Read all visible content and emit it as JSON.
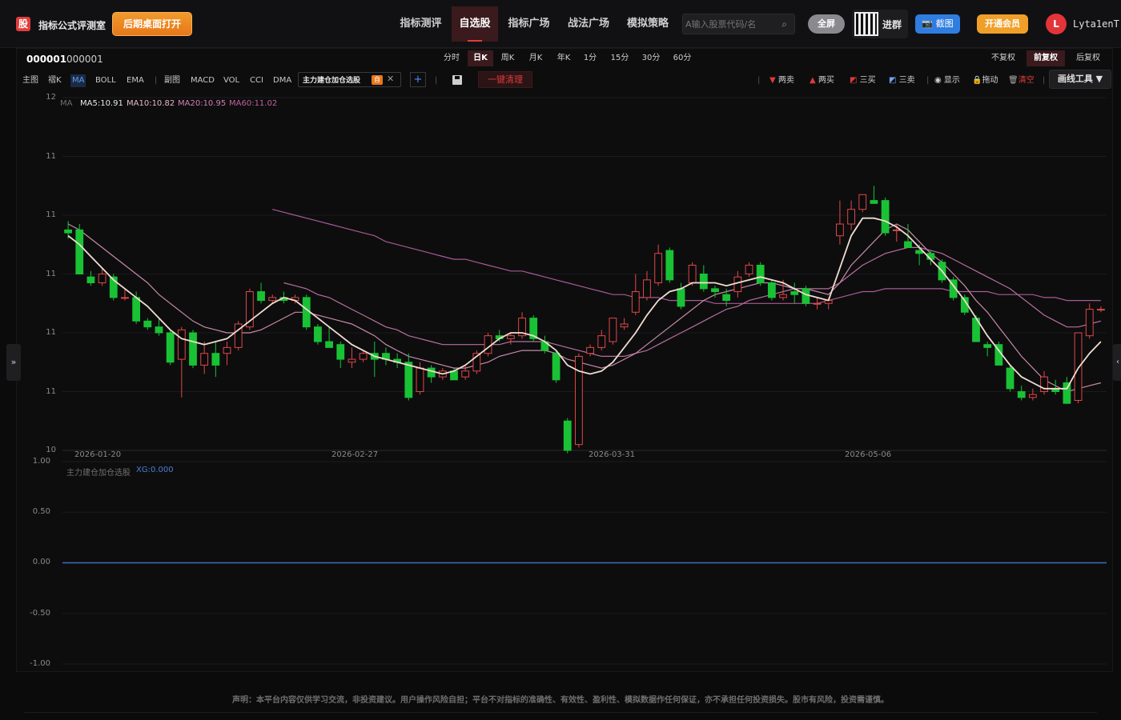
{
  "header": {
    "logo_text": "股",
    "brand": "指标公式评测室",
    "desktop_button": "后期桌面打开",
    "nav": [
      "指标测评",
      "自选股",
      "指标广场",
      "战法广场",
      "模拟策略"
    ],
    "active_nav": "自选股",
    "search_placeholder": "A输入股票代码/名",
    "fullscreen": "全屏",
    "group_label": "进群",
    "screenshot": "截图",
    "vip": "开通会员",
    "avatar_letter": "L",
    "username": "Lyta1enT"
  },
  "stock": {
    "code": "000001",
    "name": "000001"
  },
  "periods": [
    "分时",
    "日K",
    "周K",
    "月K",
    "年K",
    "1分",
    "15分",
    "30分",
    "60分"
  ],
  "active_period": "日K",
  "adjust": [
    "不复权",
    "前复权",
    "后复权"
  ],
  "active_adjust": "前复权",
  "indicators_main": [
    "主图",
    "褶K",
    "MA",
    "BOLL",
    "EMA"
  ],
  "indicators_sub": [
    "副图",
    "MACD",
    "VOL",
    "CCI",
    "DMA"
  ],
  "custom_tag": {
    "label": "主力建仓加仓选股",
    "badge": "自"
  },
  "clear_button": "一键清理",
  "tools": [
    "两卖",
    "两买",
    "三买",
    "三卖",
    "显示",
    "拖动",
    "清空"
  ],
  "draw_tool": "画线工具 ▼",
  "main_chart": {
    "y_ticks": [
      "12",
      "11",
      "11",
      "11",
      "11",
      "11",
      "10"
    ],
    "x_ticks": [
      "2026-01-20",
      "2026-02-27",
      "2026-03-31",
      "2026-05-06"
    ],
    "legend": [
      {
        "text": "MA",
        "color": "#6f6f6f"
      },
      {
        "text": "MA5:10.91",
        "color": "#e8e8e8"
      },
      {
        "text": "MA10:10.82",
        "color": "#e8b8c8"
      },
      {
        "text": "MA20:10.95",
        "color": "#d57fb0"
      },
      {
        "text": "MA60:11.02",
        "color": "#c060a0"
      }
    ],
    "colors": {
      "up": "#e04848",
      "down": "#19c234",
      "ma5": "#f0dcd0",
      "ma10": "#c88aa8",
      "ma20": "#b86e9e",
      "ma60": "#a85a94"
    }
  },
  "chart_data": {
    "type": "candlestick",
    "ylim": [
      10.35,
      11.55
    ],
    "candles": [
      {
        "o": 11.1,
        "h": 11.13,
        "l": 11.07,
        "c": 11.09
      },
      {
        "o": 11.1,
        "h": 11.12,
        "l": 10.95,
        "c": 10.95
      },
      {
        "o": 10.94,
        "h": 10.96,
        "l": 10.91,
        "c": 10.92
      },
      {
        "o": 10.92,
        "h": 10.97,
        "l": 10.91,
        "c": 10.95
      },
      {
        "o": 10.94,
        "h": 10.95,
        "l": 10.86,
        "c": 10.87
      },
      {
        "o": 10.87,
        "h": 10.9,
        "l": 10.86,
        "c": 10.87
      },
      {
        "o": 10.87,
        "h": 10.89,
        "l": 10.78,
        "c": 10.79
      },
      {
        "o": 10.79,
        "h": 10.8,
        "l": 10.76,
        "c": 10.77
      },
      {
        "o": 10.77,
        "h": 10.8,
        "l": 10.74,
        "c": 10.75
      },
      {
        "o": 10.75,
        "h": 10.76,
        "l": 10.64,
        "c": 10.65
      },
      {
        "o": 10.66,
        "h": 10.77,
        "l": 10.53,
        "c": 10.76
      },
      {
        "o": 10.75,
        "h": 10.76,
        "l": 10.63,
        "c": 10.64
      },
      {
        "o": 10.64,
        "h": 10.72,
        "l": 10.61,
        "c": 10.68
      },
      {
        "o": 10.68,
        "h": 10.72,
        "l": 10.6,
        "c": 10.64
      },
      {
        "o": 10.68,
        "h": 10.72,
        "l": 10.64,
        "c": 10.7
      },
      {
        "o": 10.7,
        "h": 10.79,
        "l": 10.69,
        "c": 10.78
      },
      {
        "o": 10.77,
        "h": 10.9,
        "l": 10.76,
        "c": 10.89
      },
      {
        "o": 10.89,
        "h": 10.92,
        "l": 10.85,
        "c": 10.86
      },
      {
        "o": 10.86,
        "h": 10.88,
        "l": 10.85,
        "c": 10.87
      },
      {
        "o": 10.87,
        "h": 10.89,
        "l": 10.85,
        "c": 10.86
      },
      {
        "o": 10.86,
        "h": 10.88,
        "l": 10.85,
        "c": 10.87
      },
      {
        "o": 10.87,
        "h": 10.88,
        "l": 10.76,
        "c": 10.77
      },
      {
        "o": 10.77,
        "h": 10.78,
        "l": 10.71,
        "c": 10.72
      },
      {
        "o": 10.72,
        "h": 10.77,
        "l": 10.71,
        "c": 10.7
      },
      {
        "o": 10.71,
        "h": 10.72,
        "l": 10.63,
        "c": 10.66
      },
      {
        "o": 10.65,
        "h": 10.7,
        "l": 10.63,
        "c": 10.66
      },
      {
        "o": 10.66,
        "h": 10.69,
        "l": 10.65,
        "c": 10.68
      },
      {
        "o": 10.68,
        "h": 10.72,
        "l": 10.6,
        "c": 10.66
      },
      {
        "o": 10.68,
        "h": 10.7,
        "l": 10.64,
        "c": 10.66
      },
      {
        "o": 10.66,
        "h": 10.68,
        "l": 10.63,
        "c": 10.65
      },
      {
        "o": 10.65,
        "h": 10.68,
        "l": 10.52,
        "c": 10.53
      },
      {
        "o": 10.55,
        "h": 10.65,
        "l": 10.54,
        "c": 10.63
      },
      {
        "o": 10.63,
        "h": 10.64,
        "l": 10.58,
        "c": 10.6
      },
      {
        "o": 10.6,
        "h": 10.63,
        "l": 10.59,
        "c": 10.62
      },
      {
        "o": 10.62,
        "h": 10.63,
        "l": 10.59,
        "c": 10.59
      },
      {
        "o": 10.6,
        "h": 10.64,
        "l": 10.59,
        "c": 10.62
      },
      {
        "o": 10.62,
        "h": 10.69,
        "l": 10.61,
        "c": 10.68
      },
      {
        "o": 10.68,
        "h": 10.75,
        "l": 10.67,
        "c": 10.74
      },
      {
        "o": 10.74,
        "h": 10.76,
        "l": 10.72,
        "c": 10.73
      },
      {
        "o": 10.73,
        "h": 10.75,
        "l": 10.71,
        "c": 10.74
      },
      {
        "o": 10.74,
        "h": 10.82,
        "l": 10.73,
        "c": 10.8
      },
      {
        "o": 10.8,
        "h": 10.81,
        "l": 10.72,
        "c": 10.73
      },
      {
        "o": 10.72,
        "h": 10.74,
        "l": 10.68,
        "c": 10.69
      },
      {
        "o": 10.68,
        "h": 10.69,
        "l": 10.58,
        "c": 10.59
      },
      {
        "o": 10.45,
        "h": 10.46,
        "l": 10.34,
        "c": 10.35
      },
      {
        "o": 10.37,
        "h": 10.68,
        "l": 10.36,
        "c": 10.67
      },
      {
        "o": 10.68,
        "h": 10.71,
        "l": 10.67,
        "c": 10.7
      },
      {
        "o": 10.7,
        "h": 10.76,
        "l": 10.69,
        "c": 10.74
      },
      {
        "o": 10.72,
        "h": 10.8,
        "l": 10.71,
        "c": 10.8
      },
      {
        "o": 10.77,
        "h": 10.8,
        "l": 10.76,
        "c": 10.78
      },
      {
        "o": 10.82,
        "h": 10.95,
        "l": 10.81,
        "c": 10.89
      },
      {
        "o": 10.87,
        "h": 10.96,
        "l": 10.86,
        "c": 10.93
      },
      {
        "o": 10.92,
        "h": 11.05,
        "l": 10.91,
        "c": 11.02
      },
      {
        "o": 11.03,
        "h": 11.04,
        "l": 10.92,
        "c": 10.93
      },
      {
        "o": 10.9,
        "h": 10.92,
        "l": 10.83,
        "c": 10.84
      },
      {
        "o": 10.92,
        "h": 10.99,
        "l": 10.91,
        "c": 10.98
      },
      {
        "o": 10.95,
        "h": 10.98,
        "l": 10.89,
        "c": 10.9
      },
      {
        "o": 10.9,
        "h": 10.91,
        "l": 10.87,
        "c": 10.89
      },
      {
        "o": 10.88,
        "h": 10.9,
        "l": 10.84,
        "c": 10.86
      },
      {
        "o": 10.89,
        "h": 10.96,
        "l": 10.87,
        "c": 10.94
      },
      {
        "o": 10.95,
        "h": 10.99,
        "l": 10.94,
        "c": 10.98
      },
      {
        "o": 10.98,
        "h": 10.99,
        "l": 10.91,
        "c": 10.92
      },
      {
        "o": 10.92,
        "h": 10.93,
        "l": 10.86,
        "c": 10.87
      },
      {
        "o": 10.87,
        "h": 10.93,
        "l": 10.86,
        "c": 10.88
      },
      {
        "o": 10.89,
        "h": 10.92,
        "l": 10.85,
        "c": 10.88
      },
      {
        "o": 10.9,
        "h": 10.91,
        "l": 10.84,
        "c": 10.85
      },
      {
        "o": 10.85,
        "h": 10.87,
        "l": 10.83,
        "c": 10.85
      },
      {
        "o": 10.85,
        "h": 10.87,
        "l": 10.83,
        "c": 10.86
      },
      {
        "o": 11.08,
        "h": 11.2,
        "l": 11.05,
        "c": 11.12
      },
      {
        "o": 11.12,
        "h": 11.2,
        "l": 11.1,
        "c": 11.17
      },
      {
        "o": 11.17,
        "h": 11.22,
        "l": 11.16,
        "c": 11.22
      },
      {
        "o": 11.2,
        "h": 11.25,
        "l": 11.19,
        "c": 11.19
      },
      {
        "o": 11.2,
        "h": 11.21,
        "l": 11.08,
        "c": 11.09
      },
      {
        "o": 11.1,
        "h": 11.12,
        "l": 11.06,
        "c": 11.1
      },
      {
        "o": 11.06,
        "h": 11.12,
        "l": 11.05,
        "c": 11.04
      },
      {
        "o": 11.03,
        "h": 11.05,
        "l": 10.98,
        "c": 11.02
      },
      {
        "o": 11.02,
        "h": 11.03,
        "l": 10.98,
        "c": 11.0
      },
      {
        "o": 10.99,
        "h": 11.0,
        "l": 10.92,
        "c": 10.93
      },
      {
        "o": 10.93,
        "h": 10.94,
        "l": 10.86,
        "c": 10.87
      },
      {
        "o": 10.87,
        "h": 10.88,
        "l": 10.81,
        "c": 10.82
      },
      {
        "o": 10.8,
        "h": 10.81,
        "l": 10.72,
        "c": 10.72
      },
      {
        "o": 10.71,
        "h": 10.72,
        "l": 10.67,
        "c": 10.7
      },
      {
        "o": 10.71,
        "h": 10.72,
        "l": 10.64,
        "c": 10.64
      },
      {
        "o": 10.63,
        "h": 10.64,
        "l": 10.55,
        "c": 10.56
      },
      {
        "o": 10.55,
        "h": 10.57,
        "l": 10.52,
        "c": 10.53
      },
      {
        "o": 10.53,
        "h": 10.56,
        "l": 10.52,
        "c": 10.54
      },
      {
        "o": 10.55,
        "h": 10.62,
        "l": 10.54,
        "c": 10.6
      },
      {
        "o": 10.56,
        "h": 10.59,
        "l": 10.54,
        "c": 10.55
      },
      {
        "o": 10.58,
        "h": 10.6,
        "l": 10.52,
        "c": 10.51
      },
      {
        "o": 10.52,
        "h": 10.75,
        "l": 10.51,
        "c": 10.75
      },
      {
        "o": 10.74,
        "h": 10.85,
        "l": 10.73,
        "c": 10.83
      },
      {
        "o": 10.83,
        "h": 10.84,
        "l": 10.82,
        "c": 10.83
      }
    ],
    "ma5": [
      11.08,
      11.05,
      11.01,
      10.97,
      10.93,
      10.9,
      10.87,
      10.84,
      10.8,
      10.76,
      10.73,
      10.72,
      10.71,
      10.72,
      10.73,
      10.76,
      10.79,
      10.82,
      10.85,
      10.87,
      10.86,
      10.83,
      10.8,
      10.77,
      10.74,
      10.71,
      10.69,
      10.67,
      10.66,
      10.65,
      10.64,
      10.63,
      10.62,
      10.61,
      10.62,
      10.64,
      10.67,
      10.7,
      10.73,
      10.75,
      10.75,
      10.74,
      10.72,
      10.69,
      10.64,
      10.62,
      10.61,
      10.62,
      10.65,
      10.7,
      10.75,
      10.81,
      10.86,
      10.89,
      10.9,
      10.92,
      10.92,
      10.92,
      10.91,
      10.92,
      10.93,
      10.94,
      10.93,
      10.92,
      10.9,
      10.88,
      10.87,
      10.86,
      10.97,
      11.08,
      11.14,
      11.14,
      11.13,
      11.11,
      11.08,
      11.04,
      11.0,
      10.96,
      10.91,
      10.86,
      10.8,
      10.74,
      10.69,
      10.64,
      10.6,
      10.58,
      10.56,
      10.56,
      10.56,
      10.63,
      10.68,
      10.72
    ],
    "ma10": [
      11.12,
      11.1,
      11.07,
      11.04,
      11.01,
      10.98,
      10.95,
      10.92,
      10.88,
      10.85,
      10.82,
      10.79,
      10.77,
      10.76,
      10.75,
      10.75,
      10.75,
      10.76,
      10.78,
      10.8,
      10.82,
      10.82,
      10.81,
      10.8,
      10.79,
      10.78,
      10.76,
      10.74,
      10.71,
      10.69,
      10.67,
      10.66,
      10.65,
      10.64,
      10.63,
      10.63,
      10.64,
      10.65,
      10.67,
      10.68,
      10.69,
      10.69,
      10.69,
      10.68,
      10.66,
      10.65,
      10.64,
      10.63,
      10.64,
      10.66,
      10.68,
      10.71,
      10.74,
      10.77,
      10.8,
      10.83,
      10.86,
      10.88,
      10.89,
      10.9,
      10.91,
      10.92,
      10.92,
      10.91,
      10.9,
      10.9,
      10.89,
      10.88,
      10.92,
      10.98,
      11.02,
      11.06,
      11.1,
      11.12,
      11.1,
      11.06,
      11.02,
      10.99,
      10.95,
      10.91,
      10.86,
      10.82,
      10.77,
      10.72,
      10.67,
      10.63,
      10.59,
      10.57,
      10.55,
      10.56,
      10.57,
      10.58
    ],
    "ma20": [
      null,
      null,
      null,
      null,
      null,
      null,
      null,
      null,
      null,
      null,
      null,
      null,
      null,
      null,
      null,
      null,
      null,
      null,
      null,
      10.92,
      10.91,
      10.9,
      10.88,
      10.87,
      10.85,
      10.83,
      10.81,
      10.79,
      10.77,
      10.76,
      10.74,
      10.73,
      10.72,
      10.71,
      10.71,
      10.71,
      10.71,
      10.71,
      10.71,
      10.72,
      10.72,
      10.72,
      10.72,
      10.71,
      10.7,
      10.69,
      10.68,
      10.67,
      10.67,
      10.67,
      10.68,
      10.69,
      10.71,
      10.73,
      10.75,
      10.77,
      10.79,
      10.81,
      10.83,
      10.84,
      10.86,
      10.87,
      10.88,
      10.89,
      10.9,
      10.9,
      10.9,
      10.9,
      10.92,
      10.95,
      10.98,
      11.0,
      11.02,
      11.03,
      11.04,
      11.04,
      11.03,
      11.02,
      11.0,
      10.98,
      10.96,
      10.94,
      10.92,
      10.9,
      10.87,
      10.84,
      10.81,
      10.79,
      10.77,
      10.77,
      10.78,
      10.79
    ],
    "ma60": [
      null,
      null,
      null,
      null,
      null,
      null,
      null,
      null,
      null,
      null,
      null,
      null,
      null,
      null,
      null,
      null,
      null,
      null,
      11.17,
      11.16,
      11.15,
      11.14,
      11.13,
      11.12,
      11.11,
      11.1,
      11.09,
      11.08,
      11.06,
      11.05,
      11.04,
      11.03,
      11.02,
      11.01,
      11.0,
      11.0,
      10.99,
      10.98,
      10.97,
      10.96,
      10.96,
      10.95,
      10.94,
      10.93,
      10.92,
      10.91,
      10.9,
      10.89,
      10.88,
      10.88,
      10.87,
      10.87,
      10.87,
      10.86,
      10.86,
      10.86,
      10.86,
      10.85,
      10.85,
      10.85,
      10.85,
      10.85,
      10.85,
      10.85,
      10.85,
      10.85,
      10.85,
      10.86,
      10.87,
      10.88,
      10.89,
      10.89,
      10.9,
      10.9,
      10.9,
      10.9,
      10.9,
      10.9,
      10.89,
      10.89,
      10.89,
      10.89,
      10.88,
      10.88,
      10.88,
      10.88,
      10.87,
      10.87,
      10.86,
      10.86,
      10.86,
      10.86
    ],
    "sub_chart": {
      "label": "主力建仓加仓选股",
      "xg_label": "XG:0.000",
      "y_ticks": [
        "1.00",
        "0.50",
        "0.00",
        "-0.50",
        "-1.00"
      ],
      "value": 0.0
    }
  },
  "disclaimer": "声明：本平台内容仅供学习交流，非投资建议。用户操作风险自担；平台不对指标的准确性、有效性、盈利性、模拟数据作任何保证，亦不承担任何投资损失。股市有风险，投资需谨慎。"
}
